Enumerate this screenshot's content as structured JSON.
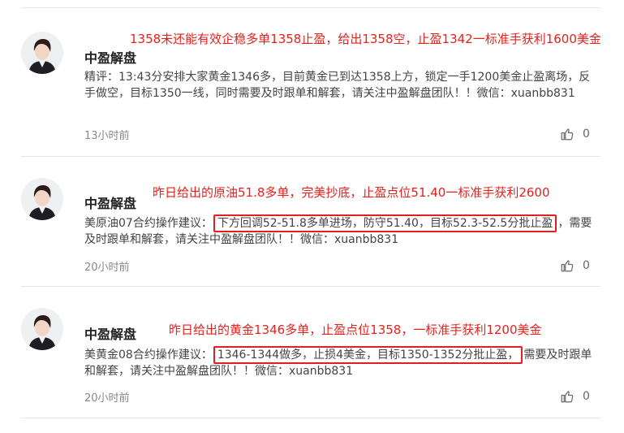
{
  "posts": [
    {
      "author": "中盈解盘",
      "note": "1358未还能有效企稳多单1358止盈，给出1358空，止盈1342一标准手获利1600美金",
      "body_text": "精评：13:43分安排大家黄金1346多，目前黄金已到达1358上方，锁定一手1200美金止盈离场，反手做空，目标1350一线，同时需要及时跟单和解套，请关注中盈解盘团队！！微信：xuanbb831",
      "time": "13小时前",
      "likes": "0"
    },
    {
      "author": "中盈解盘",
      "note": "昨日给出的原油51.8多单，完美抄底，止盈点位51.40一标准手获利2600",
      "body_prefix": "美原油07合约操作建议：",
      "body_highlight": "下方回调52-51.8多单进场，防守51.40，目标52.3-52.5分批止盈",
      "body_suffix": "，需要及时跟单和解套，请关注中盈解盘团队！！微信：xuanbb831",
      "time": "20小时前",
      "likes": "0"
    },
    {
      "author": "中盈解盘",
      "note": "昨日给出的黄金1346多单，止盈点位1358，一标准手获利1200美金",
      "body_prefix": "美黄金08合约操作建议：",
      "body_highlight": "1346-1344做多，止损4美金，目标1350-1352分批止盈，",
      "body_suffix": "需要及时跟单和解套，请关注中盈解盘团队！！微信：xuanbb831",
      "time": "20小时前",
      "likes": "0"
    }
  ],
  "icons": {
    "like": "thumbs-up-icon",
    "avatar": "user-avatar"
  },
  "colors": {
    "note": "#e8201c",
    "highlight_border": "#e02020"
  }
}
